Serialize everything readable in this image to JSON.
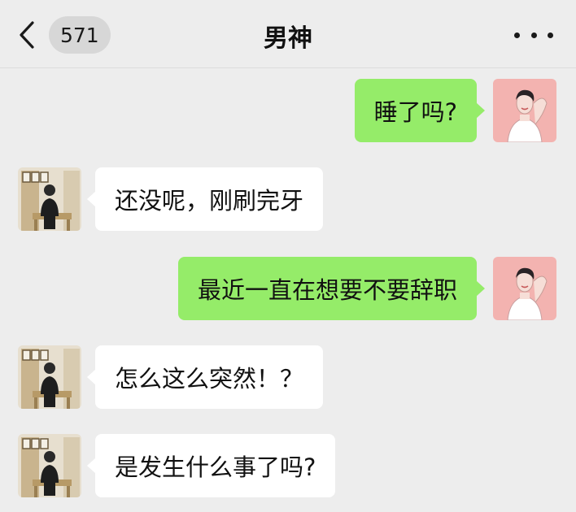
{
  "header": {
    "back_badge": "571",
    "title": "男神"
  },
  "icons": {
    "back": "chevron-left-icon",
    "more": "more-dots-icon",
    "self_avatar": "woman-illustration-avatar",
    "contact_avatar": "man-photo-avatar"
  },
  "colors": {
    "background": "#ededed",
    "sent_bubble": "#95ec69",
    "received_bubble": "#ffffff",
    "self_avatar_bg": "#f3b3b0"
  },
  "messages": [
    {
      "side": "right",
      "text": "睡了吗?"
    },
    {
      "side": "left",
      "text": "还没呢，刚刷完牙"
    },
    {
      "side": "right",
      "text": "最近一直在想要不要辞职"
    },
    {
      "side": "left",
      "text": "怎么这么突然！？"
    },
    {
      "side": "left",
      "text": "是发生什么事了吗?"
    }
  ]
}
